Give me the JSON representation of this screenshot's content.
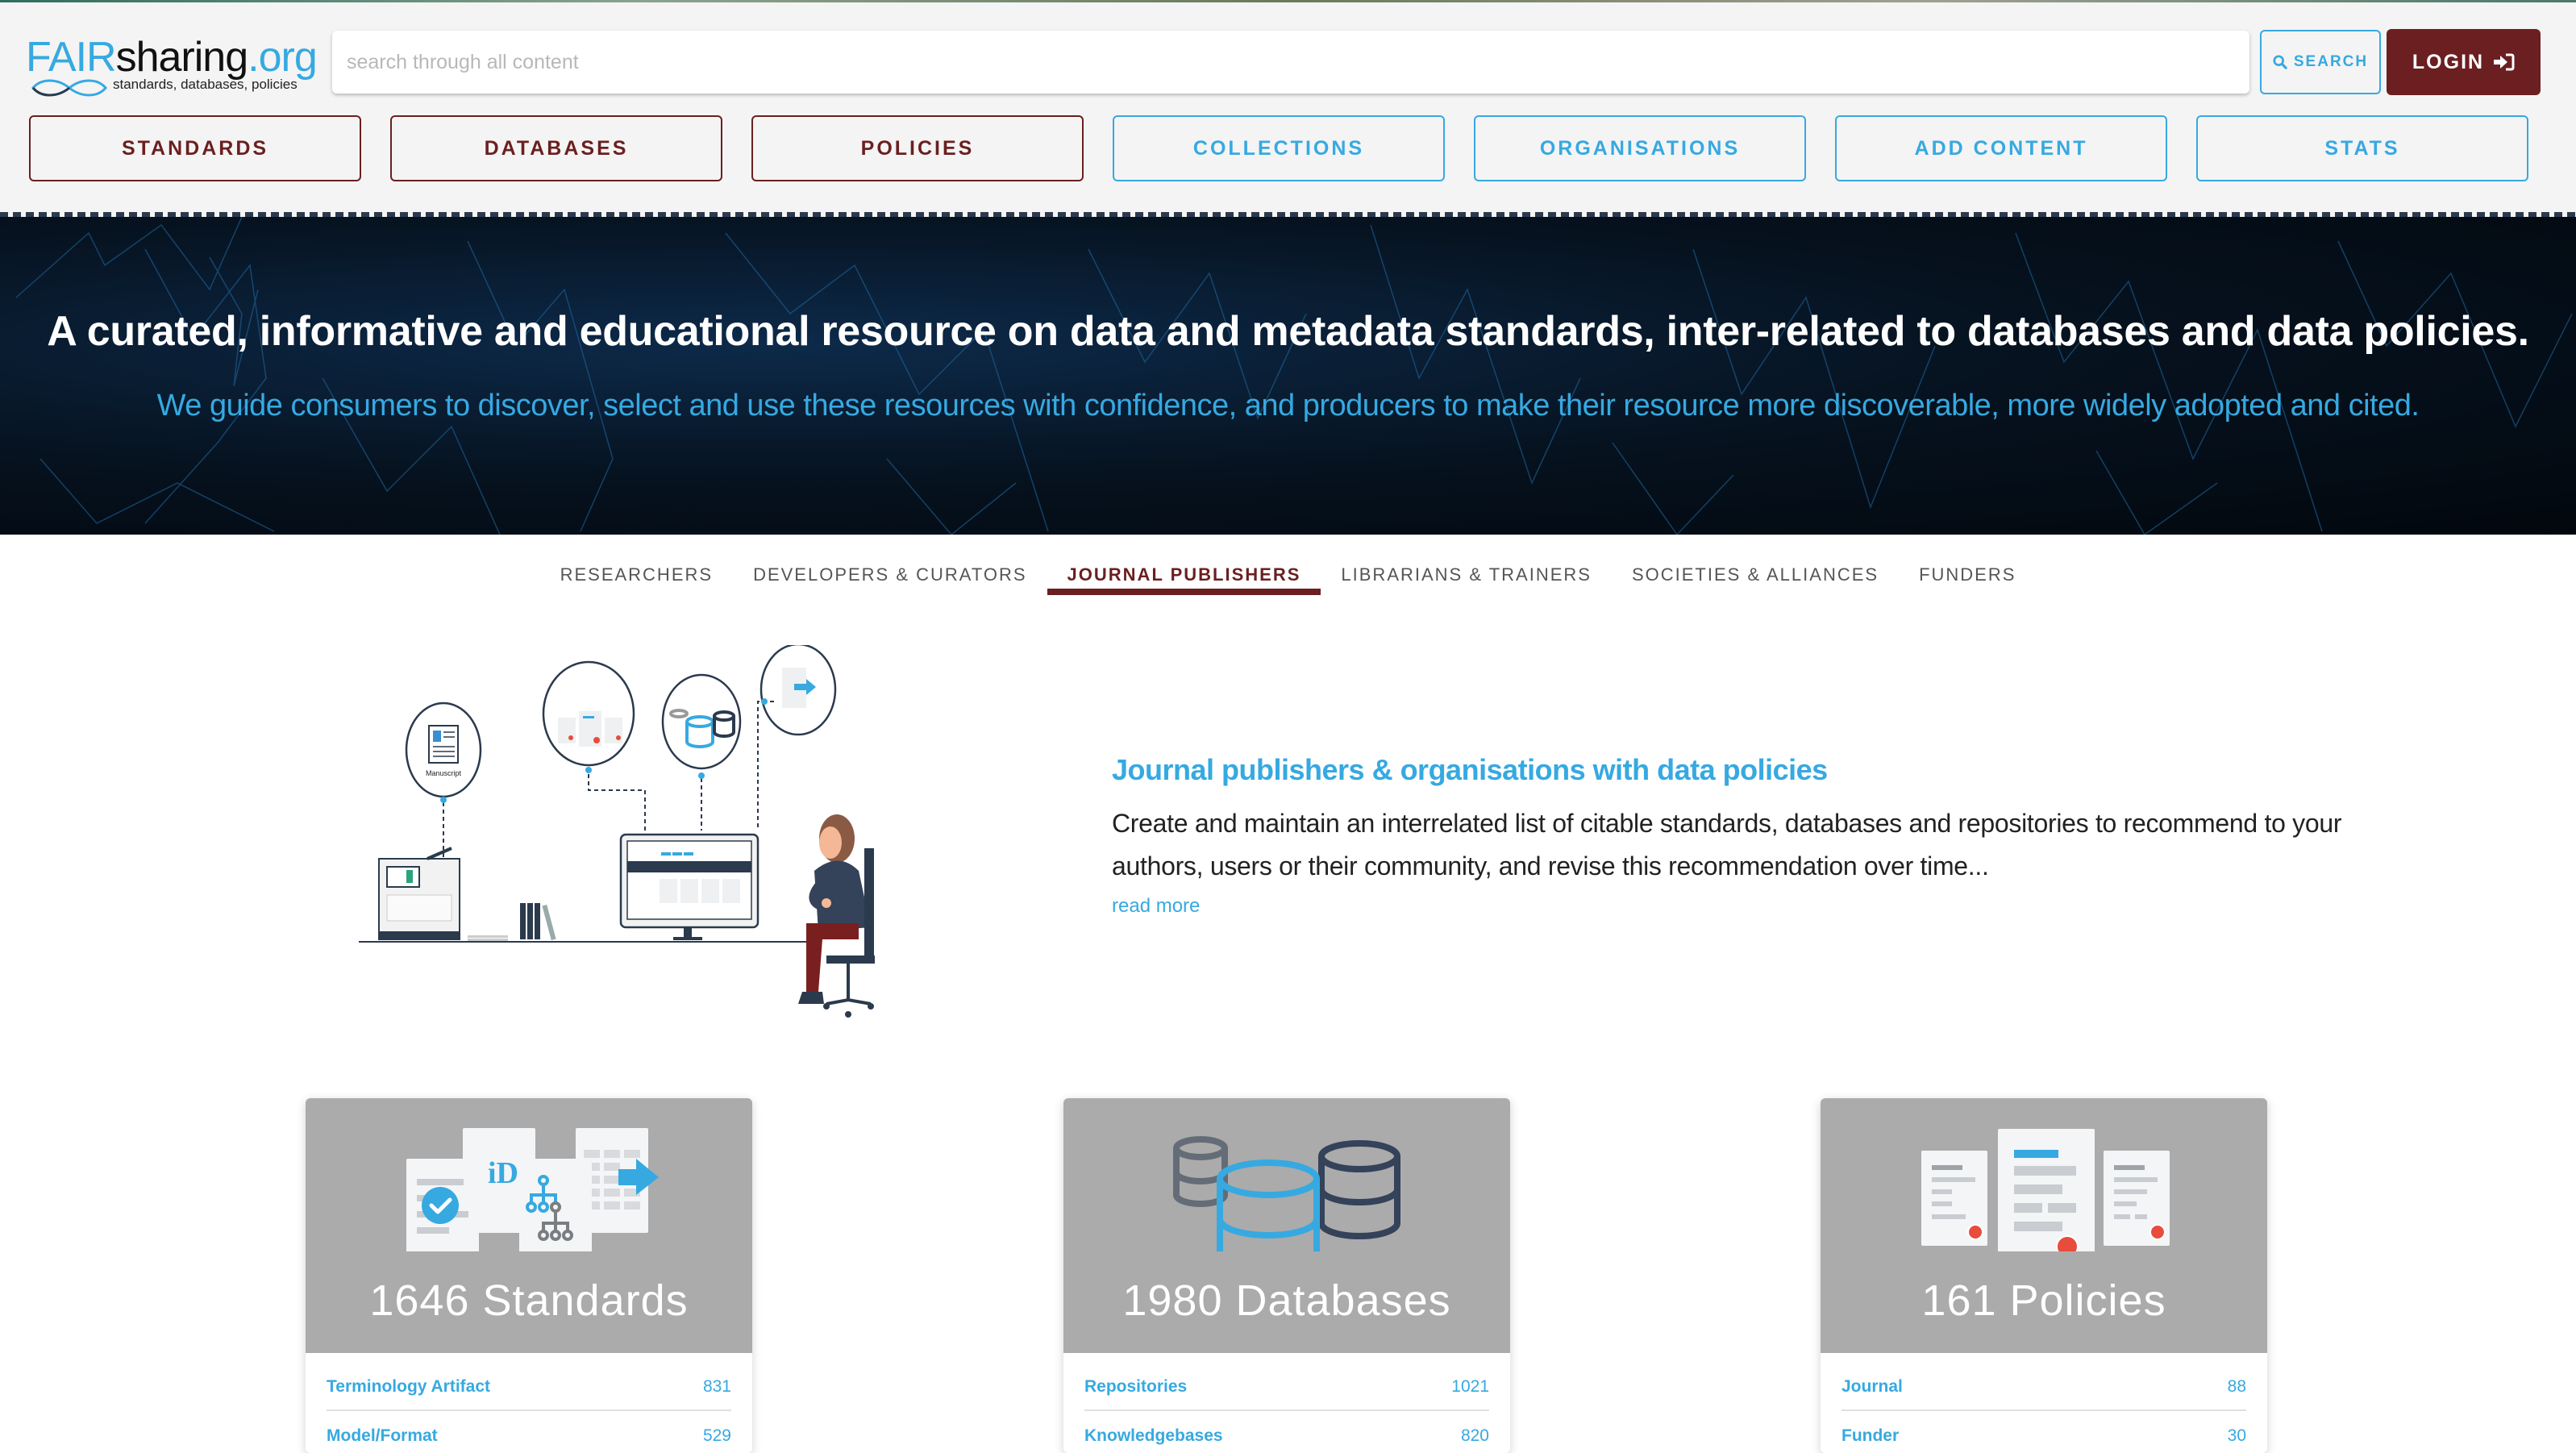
{
  "header": {
    "logo": {
      "fair": "FAIR",
      "sharing": "sharing",
      "org": ".org",
      "tagline": "standards, databases, policies"
    },
    "search": {
      "placeholder": "search through all content",
      "value": ""
    },
    "search_button": {
      "label": "SEARCH",
      "icon": "search-icon"
    },
    "login_button": {
      "label": "LOGIN",
      "icon": "sign-in-icon"
    },
    "nav": [
      {
        "label": "STANDARDS",
        "style": "dark"
      },
      {
        "label": "DATABASES",
        "style": "dark"
      },
      {
        "label": "POLICIES",
        "style": "dark"
      },
      {
        "label": "COLLECTIONS",
        "style": "light"
      },
      {
        "label": "ORGANISATIONS",
        "style": "light"
      },
      {
        "label": "ADD CONTENT",
        "style": "light"
      },
      {
        "label": "STATS",
        "style": "light"
      }
    ]
  },
  "hero": {
    "title": "A curated, informative and educational resource on data and metadata standards, inter-related to databases and data policies.",
    "subtitle": "We guide consumers to discover, select and use these resources with confidence, and producers to make their resource more discoverable, more widely adopted and cited."
  },
  "tabs": [
    {
      "label": "RESEARCHERS",
      "active": false
    },
    {
      "label": "DEVELOPERS & CURATORS",
      "active": false
    },
    {
      "label": "JOURNAL PUBLISHERS",
      "active": true
    },
    {
      "label": "LIBRARIANS & TRAINERS",
      "active": false
    },
    {
      "label": "SOCIETIES & ALLIANCES",
      "active": false
    },
    {
      "label": "FUNDERS",
      "active": false
    }
  ],
  "intro": {
    "illustration_label": "Manuscript",
    "title": "Journal publishers & organisations with data policies",
    "text": "Create and maintain an interrelated list of citable standards, databases and repositories to recommend to your authors, users or their community, and revise this recommendation over time...",
    "read_more": "read more"
  },
  "cards": [
    {
      "title": "1646 Standards",
      "icon": "standards-icon",
      "rows": [
        {
          "label": "Terminology Artifact",
          "count": "831"
        },
        {
          "label": "Model/Format",
          "count": "529"
        }
      ]
    },
    {
      "title": "1980 Databases",
      "icon": "databases-icon",
      "rows": [
        {
          "label": "Repositories",
          "count": "1021"
        },
        {
          "label": "Knowledgebases",
          "count": "820"
        }
      ]
    },
    {
      "title": "161 Policies",
      "icon": "policies-icon",
      "rows": [
        {
          "label": "Journal",
          "count": "88"
        },
        {
          "label": "Funder",
          "count": "30"
        }
      ]
    }
  ],
  "colors": {
    "brand_blue": "#36a9e1",
    "brand_maroon": "#6b1f20",
    "header_bg": "#f4f4f4",
    "card_top": "#ababab"
  }
}
